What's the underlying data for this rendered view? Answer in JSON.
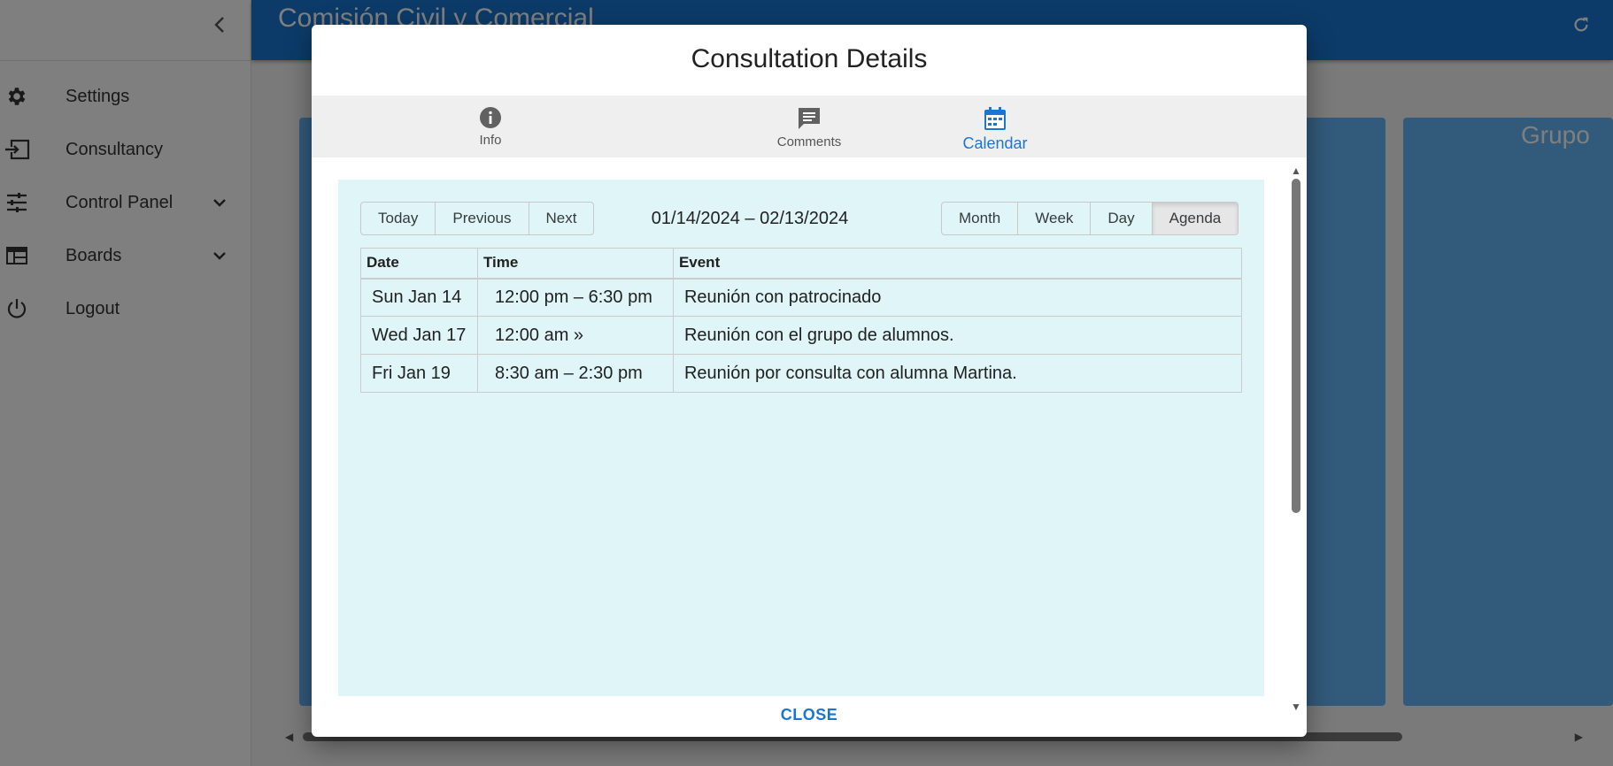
{
  "app": {
    "title": "Comisión Civil y Comercial",
    "sidebar": {
      "items": [
        {
          "label": "Settings",
          "icon": "gear-icon"
        },
        {
          "label": "Consultancy",
          "icon": "login-icon"
        },
        {
          "label": "Control Panel",
          "icon": "tune-icon"
        },
        {
          "label": "Boards",
          "icon": "table-icon"
        },
        {
          "label": "Logout",
          "icon": "power-icon"
        }
      ]
    },
    "board": {
      "column_title": "Grupo"
    }
  },
  "dialog": {
    "title": "Consultation Details",
    "tabs": [
      {
        "label": "Info",
        "icon": "info-icon"
      },
      {
        "label": "Comments",
        "icon": "comment-icon"
      },
      {
        "label": "Calendar",
        "icon": "calendar-icon",
        "active": true
      }
    ],
    "calendar": {
      "nav_buttons": {
        "today": "Today",
        "previous": "Previous",
        "next": "Next"
      },
      "range_label": "01/14/2024 – 02/13/2024",
      "views": {
        "month": "Month",
        "week": "Week",
        "day": "Day",
        "agenda": "Agenda"
      },
      "active_view": "Agenda",
      "agenda": {
        "headers": {
          "date": "Date",
          "time": "Time",
          "event": "Event"
        },
        "rows": [
          {
            "date": "Sun Jan 14",
            "time": "12:00 pm – 6:30 pm",
            "event": "Reunión con patrocinado"
          },
          {
            "date": "Wed Jan 17",
            "time": "12:00 am »",
            "event": "Reunión con el grupo de alumnos."
          },
          {
            "date": "Fri Jan 19",
            "time": "8:30 am – 2:30 pm",
            "event": "Reunión por consulta con alumna Martina."
          }
        ]
      }
    },
    "close_label": "CLOSE"
  },
  "colors": {
    "primary": "#1976d2",
    "agenda_background": "#dff5f7",
    "board_column": "#64b5f6"
  }
}
